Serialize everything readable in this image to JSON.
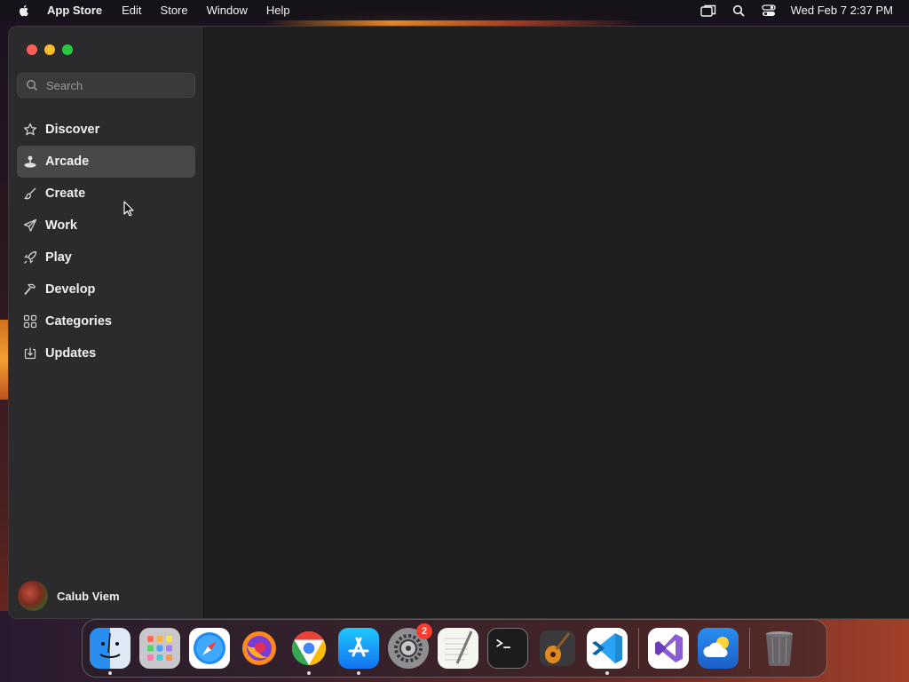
{
  "menubar": {
    "app_name": "App Store",
    "items": [
      "Edit",
      "Store",
      "Window",
      "Help"
    ],
    "clock": "Wed Feb 7  2:37 PM"
  },
  "sidebar": {
    "search_placeholder": "Search",
    "items": [
      {
        "label": "Discover",
        "icon": "star-icon",
        "active": false
      },
      {
        "label": "Arcade",
        "icon": "joystick-icon",
        "active": true
      },
      {
        "label": "Create",
        "icon": "paintbrush-icon",
        "active": false
      },
      {
        "label": "Work",
        "icon": "paperplane-icon",
        "active": false
      },
      {
        "label": "Play",
        "icon": "rocket-icon",
        "active": false
      },
      {
        "label": "Develop",
        "icon": "hammer-icon",
        "active": false
      },
      {
        "label": "Categories",
        "icon": "grid-icon",
        "active": false
      },
      {
        "label": "Updates",
        "icon": "download-icon",
        "active": false
      }
    ],
    "account_name": "Calub Viem"
  },
  "dock": {
    "apps": [
      {
        "name": "Finder",
        "running": true
      },
      {
        "name": "Launchpad",
        "running": false
      },
      {
        "name": "Safari",
        "running": false
      },
      {
        "name": "Firefox",
        "running": false
      },
      {
        "name": "Chrome",
        "running": true
      },
      {
        "name": "App Store",
        "running": true
      },
      {
        "name": "System Settings",
        "running": false,
        "badge": "2"
      },
      {
        "name": "TextEdit",
        "running": false
      },
      {
        "name": "Terminal",
        "running": false
      },
      {
        "name": "GarageBand",
        "running": false
      },
      {
        "name": "Visual Studio Code",
        "running": true
      },
      {
        "name": "Visual Studio",
        "running": false
      },
      {
        "name": "Weather",
        "running": false
      },
      {
        "name": "Trash",
        "running": false
      }
    ]
  },
  "colors": {
    "sidebar_bg": "#2b2b2d",
    "content_bg": "#1f1f1f",
    "active_item": "#48484a",
    "badge": "#ff3b30"
  }
}
